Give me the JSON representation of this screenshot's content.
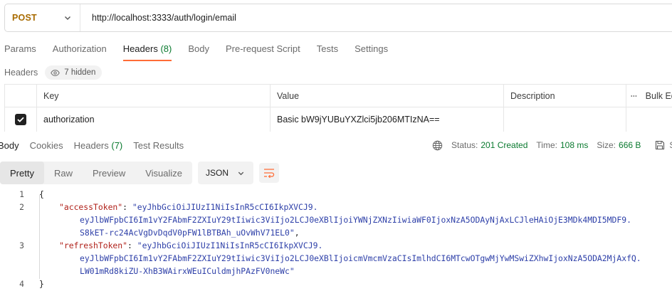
{
  "request": {
    "method": "POST",
    "url": "http://localhost:3333/auth/login/email"
  },
  "request_tabs": [
    {
      "label": "Params"
    },
    {
      "label": "Authorization"
    },
    {
      "label": "Headers",
      "count": "(8)"
    },
    {
      "label": "Body"
    },
    {
      "label": "Pre-request Script"
    },
    {
      "label": "Tests"
    },
    {
      "label": "Settings"
    }
  ],
  "headers_section": {
    "title": "Headers",
    "hidden_label": "7 hidden"
  },
  "table": {
    "columns": {
      "key": "Key",
      "value": "Value",
      "description": "Description",
      "bulk": "Bulk Edit"
    },
    "rows": [
      {
        "checked": true,
        "key": "authorization",
        "value": "Basic bW9jYUBuYXZlci5jb206MTIzNA==",
        "description": ""
      }
    ]
  },
  "response_tabs": [
    {
      "label": "Body"
    },
    {
      "label": "Cookies"
    },
    {
      "label": "Headers",
      "count": "(7)"
    },
    {
      "label": "Test Results"
    }
  ],
  "status": {
    "status_label": "Status:",
    "status_value": "201 Created",
    "time_label": "Time:",
    "time_value": "108 ms",
    "size_label": "Size:",
    "size_value": "666 B",
    "save_label": "S"
  },
  "viewer": {
    "modes": [
      "Pretty",
      "Raw",
      "Preview",
      "Visualize"
    ],
    "active_mode": "Pretty",
    "format": "JSON"
  },
  "code_lines": [
    {
      "n": "1",
      "open": "{"
    },
    {
      "n": "2",
      "key": "\"accessToken\"",
      "sep": ": ",
      "val": "\"eyJhbGciOiJIUzI1NiIsInR5cCI6IkpXVCJ9."
    },
    {
      "val": "eyJlbWFpbCI6Im1vY2FAbmF2ZXIuY29tIiwic3ViIjo2LCJ0eXBlIjoiYWNjZXNzIiwiaWF0IjoxNzA5ODAyNjAxLCJleHAiOjE3MDk4MDI5MDF9."
    },
    {
      "val": "S8kET-rc24AcVgDvDqdV0pFW1lBTBAh_uOvWhV71EL0\"",
      "tail": ","
    },
    {
      "n": "3",
      "key": "\"refreshToken\"",
      "sep": ": ",
      "val": "\"eyJhbGciOiJIUzI1NiIsInR5cCI6IkpXVCJ9."
    },
    {
      "val": "eyJlbWFpbCI6Im1vY2FAbmF2ZXIuY29tIiwic3ViIjo2LCJ0eXBlIjoicmVmcmVzaCIsImlhdCI6MTcwOTgwMjYwMSwiZXhwIjoxNzA5ODA2MjAxfQ."
    },
    {
      "val": "LW01mRd8kiZU-XhB3WAirxWEuICuldmjhPAzFV0neWc\""
    },
    {
      "n": "4",
      "open": "}"
    }
  ],
  "colors": {
    "accent": "#ff6c37",
    "method": "#a86b00",
    "success": "#0a7a2f",
    "json_key": "#b0211a",
    "json_string": "#2d3fa8"
  }
}
